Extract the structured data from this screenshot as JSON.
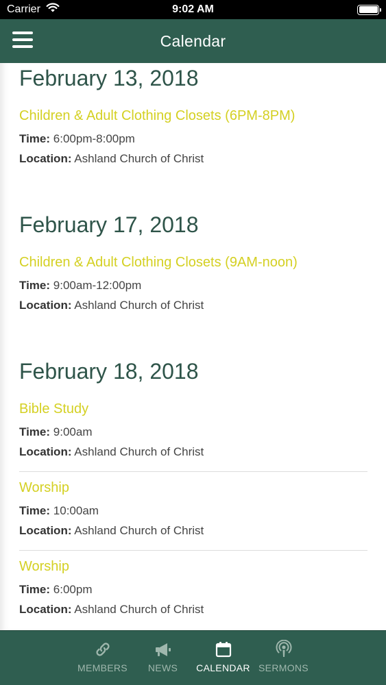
{
  "status_bar": {
    "carrier": "Carrier",
    "time": "9:02 AM"
  },
  "nav": {
    "title": "Calendar"
  },
  "labels": {
    "time": "Time:",
    "location": "Location:"
  },
  "sections": [
    {
      "date": "February 13, 2018",
      "events": [
        {
          "title": "Children & Adult Clothing Closets (6PM-8PM)",
          "time": "6:00pm-8:00pm",
          "location": "Ashland Church of Christ"
        }
      ]
    },
    {
      "date": "February 17, 2018",
      "events": [
        {
          "title": "Children & Adult Clothing Closets (9AM-noon)",
          "time": "9:00am-12:00pm",
          "location": "Ashland Church of Christ"
        }
      ]
    },
    {
      "date": "February 18, 2018",
      "events": [
        {
          "title": "Bible Study",
          "time": "9:00am",
          "location": "Ashland Church of Christ"
        },
        {
          "title": "Worship",
          "time": "10:00am",
          "location": "Ashland Church of Christ"
        },
        {
          "title": "Worship",
          "time": "6:00pm",
          "location": "Ashland Church of Christ"
        }
      ]
    }
  ],
  "tabs": [
    {
      "label": "MEMBERS",
      "icon": "link-icon",
      "active": false
    },
    {
      "label": "NEWS",
      "icon": "megaphone-icon",
      "active": false
    },
    {
      "label": "CALENDAR",
      "icon": "calendar-icon",
      "active": true
    },
    {
      "label": "SERMONS",
      "icon": "podcast-icon",
      "active": false
    }
  ],
  "colors": {
    "brand": "#2f5e50",
    "event_title": "#d4d022",
    "date_heading": "#2e5449"
  }
}
